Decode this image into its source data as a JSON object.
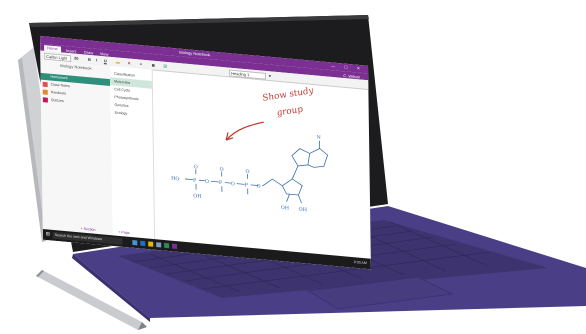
{
  "window": {
    "title": "Biology Notebook",
    "controls": [
      "—",
      "☐",
      "✕"
    ]
  },
  "ribbon": {
    "tabs": [
      "Home",
      "Insert",
      "Draw",
      "View"
    ],
    "active_tab": "Home",
    "user": "C. Wilson"
  },
  "toolbar": {
    "font": "Calibri Light",
    "font_size": "20",
    "bold": "B",
    "italic": "I",
    "underline": "U",
    "style": "Heading 1"
  },
  "notebook": {
    "title": "Biology Notebook",
    "sections": [
      {
        "label": "Homework",
        "color": "#2f8f7a",
        "active": true
      },
      {
        "label": "Class Notes",
        "color": "#d9534f"
      },
      {
        "label": "Handouts",
        "color": "#e08a2c"
      },
      {
        "label": "Quizzes",
        "color": "#c2185b"
      }
    ],
    "add_section": "+ Section"
  },
  "pages": {
    "items": [
      "Classification",
      "Molecules",
      "Cell Cycle",
      "Photosynthesis",
      "Genetics",
      "Ecology"
    ],
    "active_index": 1,
    "add_page": "+ Page"
  },
  "canvas": {
    "note_line1": "Show study",
    "note_line2": "group",
    "formula_left": "HO",
    "oh_labels": [
      "OH",
      "OH",
      "OH"
    ]
  },
  "taskbar": {
    "search_placeholder": "Search the web and Windows",
    "clock": "9:30 AM"
  },
  "colors": {
    "onenote_purple": "#7b2f93",
    "ink_red": "#c0392b",
    "ink_blue": "#3b6fb0",
    "keyboard": "#4a3f86"
  }
}
